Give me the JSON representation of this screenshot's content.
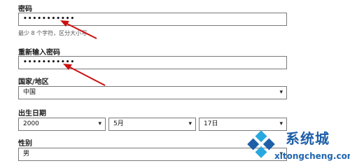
{
  "form": {
    "password": {
      "label": "密码",
      "value": "•••••••••••",
      "hint": "最少 8 个字符，区分大小写"
    },
    "confirm": {
      "label": "重新输入密码",
      "value": "•••••••••••"
    },
    "region": {
      "label": "国家/地区",
      "selected": "中国"
    },
    "birthdate": {
      "label": "出生日期",
      "year": "2000",
      "month": "5月",
      "day": "17日"
    },
    "gender": {
      "label": "性别",
      "selected": "男"
    }
  },
  "watermark": {
    "brand": "系统城",
    "url": "xitongcheng.com"
  },
  "colors": {
    "arrow": "#cc1111",
    "brand_blue": "#1e5fa8",
    "brand_cyan": "#29a8e0"
  }
}
